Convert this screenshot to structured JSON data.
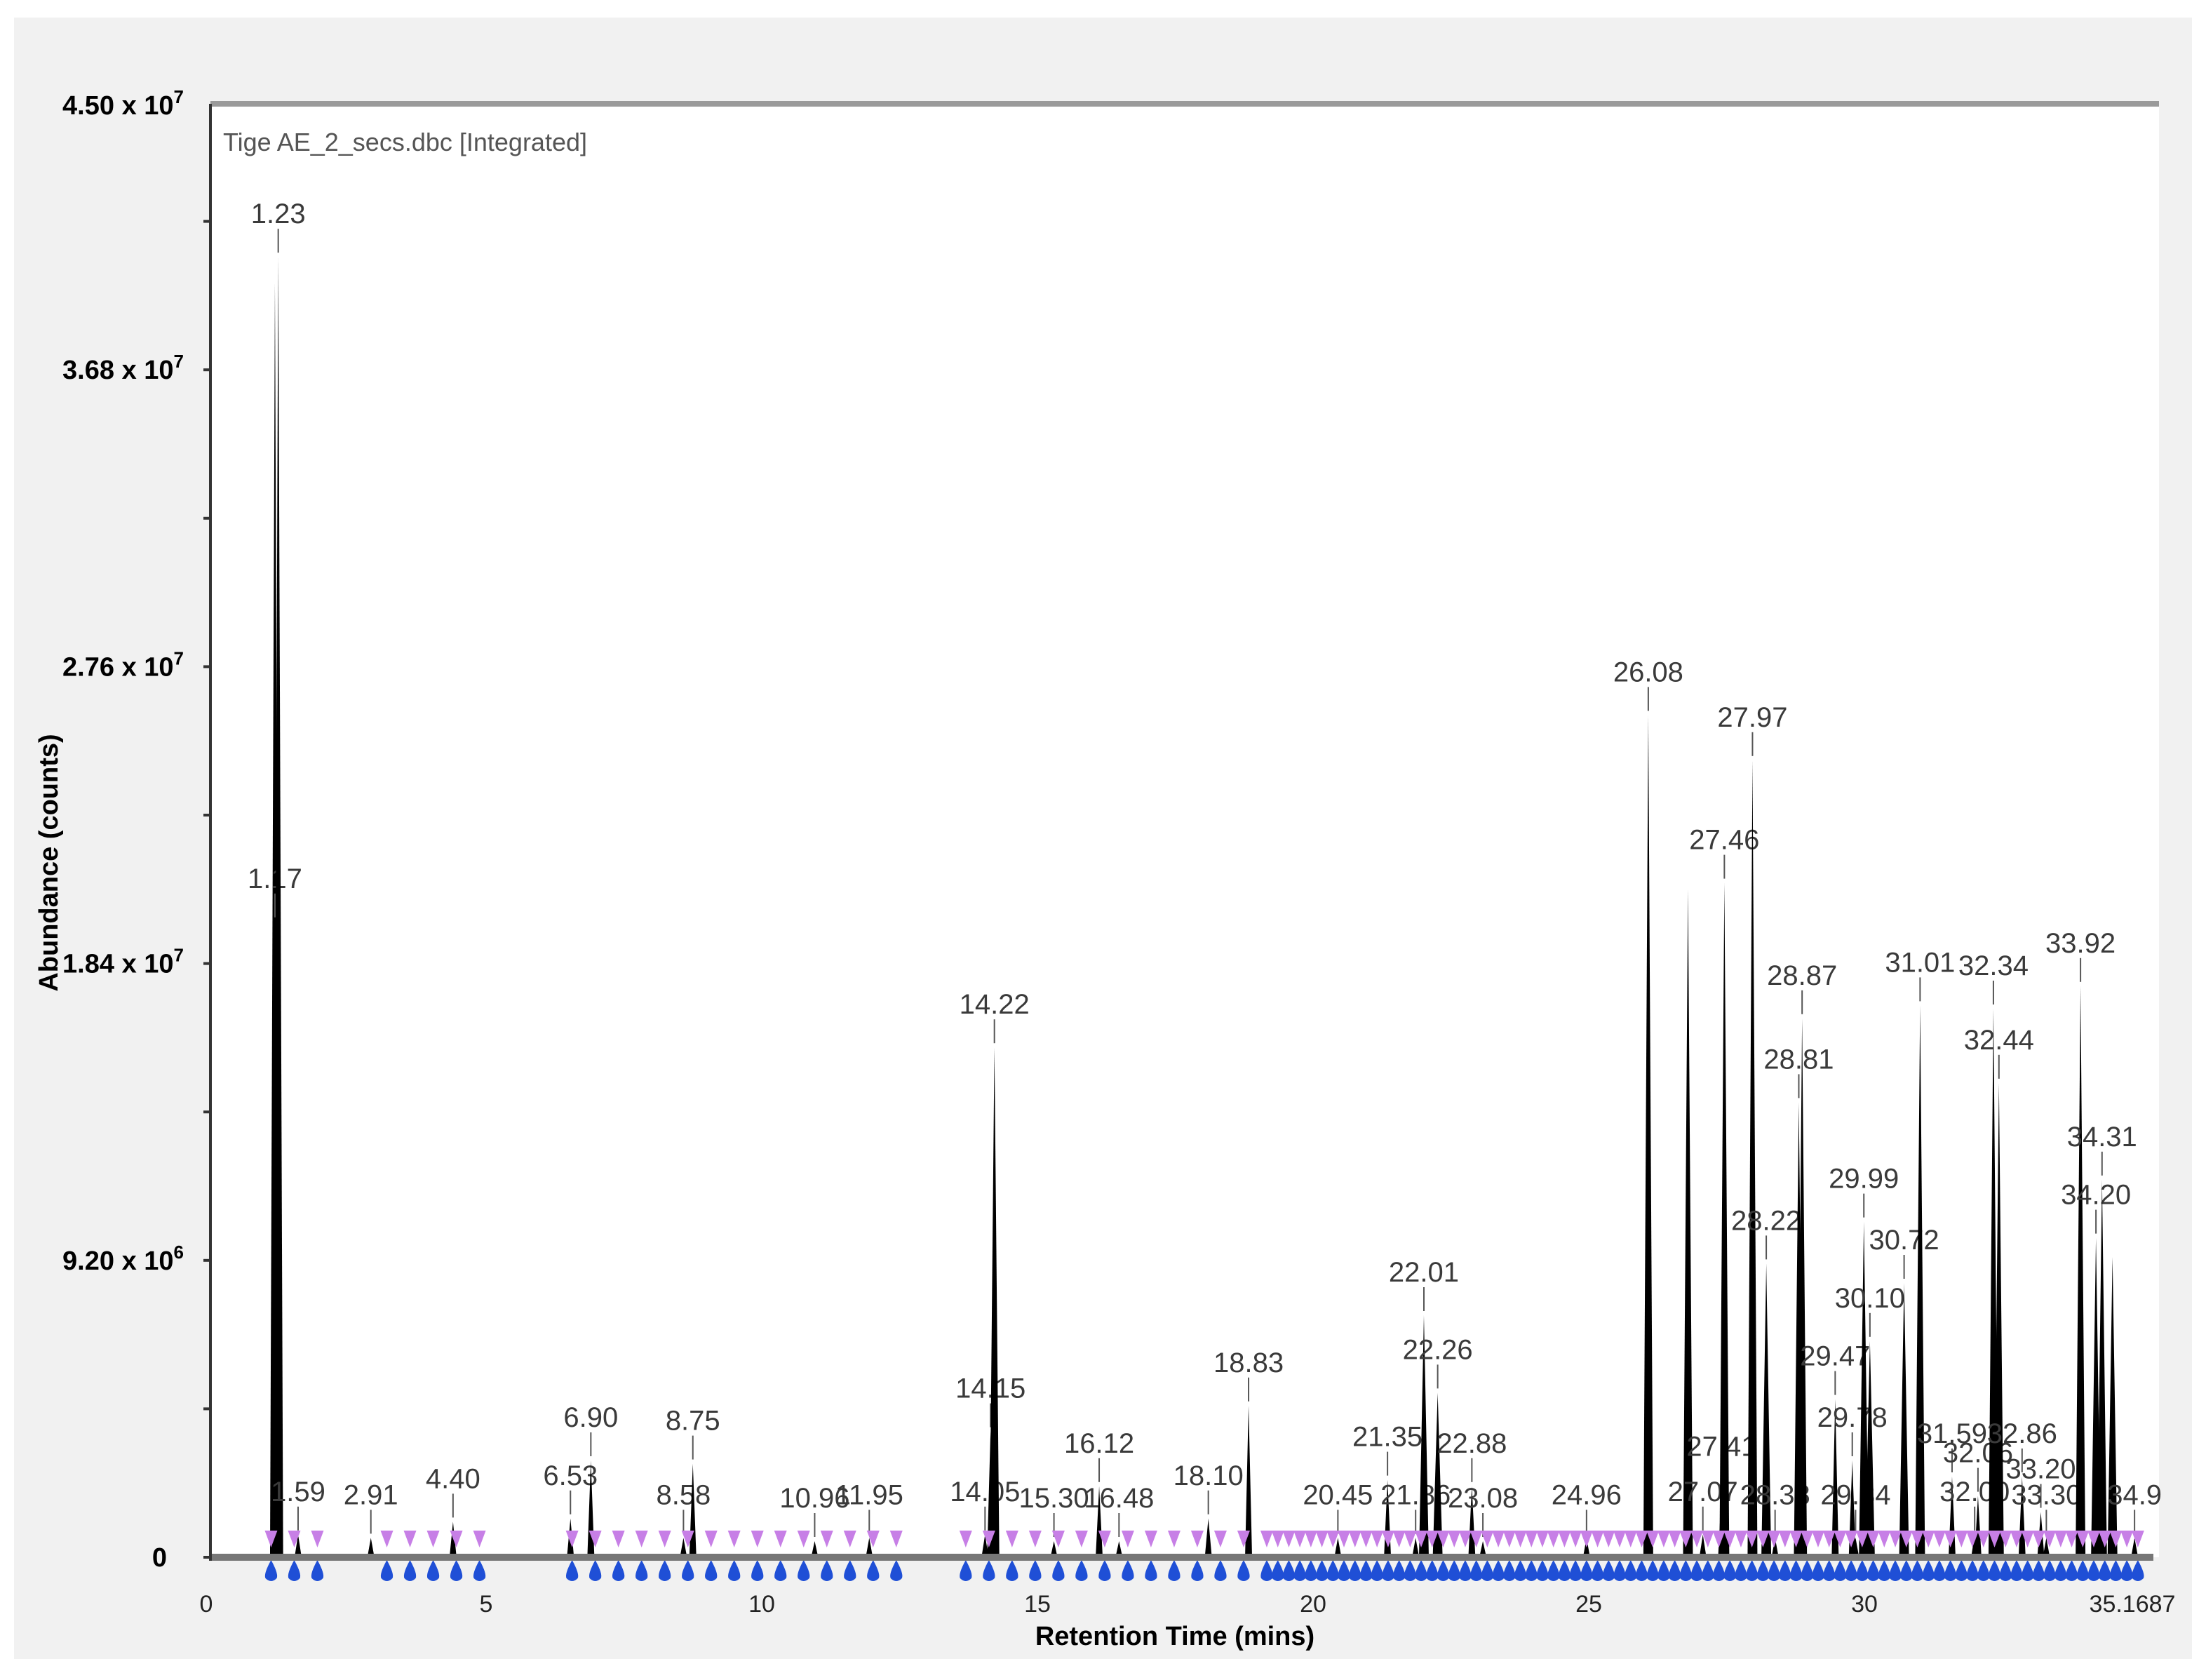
{
  "chart_data": {
    "type": "line",
    "title": "Tige AE_2_secs.dbc [Integrated]",
    "xlabel": "Retention Time (mins)",
    "ylabel": "Abundance (counts)",
    "xlim": [
      0,
      35.1687
    ],
    "ylim": [
      0,
      45000000
    ],
    "grid": false,
    "legend": "none",
    "x_ticks": [
      {
        "value": 0,
        "label": "0"
      },
      {
        "value": 5,
        "label": "5"
      },
      {
        "value": 10,
        "label": "10"
      },
      {
        "value": 15,
        "label": "15"
      },
      {
        "value": 20,
        "label": "20"
      },
      {
        "value": 25,
        "label": "25"
      },
      {
        "value": 30,
        "label": "30"
      }
    ],
    "x_end_label": "35.1687",
    "y_ticks": [
      {
        "value": 0,
        "mant": "0",
        "exp": ""
      },
      {
        "value": 9200000,
        "mant": "9.20 x 10",
        "exp": "6"
      },
      {
        "value": 18400000,
        "mant": "1.84 x 10",
        "exp": "7"
      },
      {
        "value": 27600000,
        "mant": "2.76 x 10",
        "exp": "7"
      },
      {
        "value": 36800000,
        "mant": "3.68 x 10",
        "exp": "7"
      },
      {
        "value": 45000000,
        "mant": "4.50 x 10",
        "exp": "7"
      }
    ],
    "y_minor_step": 4600000,
    "peaks": [
      {
        "rt": 1.17,
        "label": "1.17",
        "abundance": 39500000,
        "label_at": 19700000
      },
      {
        "rt": 1.23,
        "label": "1.23",
        "abundance": 40300000
      },
      {
        "rt": 1.59,
        "label": "1.59",
        "abundance": 700000
      },
      {
        "rt": 2.91,
        "label": "2.91",
        "abundance": 600000
      },
      {
        "rt": 4.4,
        "label": "4.40",
        "abundance": 1100000
      },
      {
        "rt": 6.53,
        "label": "6.53",
        "abundance": 1200000
      },
      {
        "rt": 6.9,
        "label": "6.90",
        "abundance": 3000000
      },
      {
        "rt": 8.58,
        "label": "8.58",
        "abundance": 600000
      },
      {
        "rt": 8.75,
        "label": "8.75",
        "abundance": 2900000
      },
      {
        "rt": 10.96,
        "label": "10.96",
        "abundance": 500000
      },
      {
        "rt": 11.95,
        "label": "11.95",
        "abundance": 600000
      },
      {
        "rt": 14.05,
        "label": "14.05",
        "abundance": 700000
      },
      {
        "rt": 14.15,
        "label": "14.15",
        "abundance": 3900000
      },
      {
        "rt": 14.22,
        "label": "14.22",
        "abundance": 15800000
      },
      {
        "rt": 15.3,
        "label": "15.30",
        "abundance": 500000
      },
      {
        "rt": 16.12,
        "label": "16.12",
        "abundance": 2200000
      },
      {
        "rt": 16.48,
        "label": "16.48",
        "abundance": 500000
      },
      {
        "rt": 18.1,
        "label": "18.10",
        "abundance": 1200000
      },
      {
        "rt": 18.83,
        "label": "18.83",
        "abundance": 4700000
      },
      {
        "rt": 20.45,
        "label": "20.45",
        "abundance": 600000
      },
      {
        "rt": 21.35,
        "label": "21.35",
        "abundance": 2400000
      },
      {
        "rt": 21.86,
        "label": "21.86",
        "abundance": 600000
      },
      {
        "rt": 22.01,
        "label": "22.01",
        "abundance": 7500000
      },
      {
        "rt": 22.26,
        "label": "22.26",
        "abundance": 5100000
      },
      {
        "rt": 22.88,
        "label": "22.88",
        "abundance": 2200000
      },
      {
        "rt": 23.08,
        "label": "23.08",
        "abundance": 500000
      },
      {
        "rt": 24.96,
        "label": "24.96",
        "abundance": 600000
      },
      {
        "rt": 26.08,
        "label": "26.08",
        "abundance": 26100000
      },
      {
        "rt": 26.8,
        "label": "",
        "abundance": 20700000
      },
      {
        "rt": 27.07,
        "label": "27.07",
        "abundance": 700000
      },
      {
        "rt": 27.41,
        "label": "27.41",
        "abundance": 2100000
      },
      {
        "rt": 27.46,
        "label": "27.46",
        "abundance": 20900000
      },
      {
        "rt": 27.97,
        "label": "27.97",
        "abundance": 24700000
      },
      {
        "rt": 28.22,
        "label": "28.22",
        "abundance": 9100000
      },
      {
        "rt": 28.38,
        "label": "28.38",
        "abundance": 600000
      },
      {
        "rt": 28.81,
        "label": "28.81",
        "abundance": 14100000
      },
      {
        "rt": 28.87,
        "label": "28.87",
        "abundance": 16700000
      },
      {
        "rt": 29.47,
        "label": "29.47",
        "abundance": 4900000
      },
      {
        "rt": 29.78,
        "label": "29.78",
        "abundance": 3000000
      },
      {
        "rt": 29.84,
        "label": "29.84",
        "abundance": 600000
      },
      {
        "rt": 29.99,
        "label": "29.99",
        "abundance": 10400000
      },
      {
        "rt": 30.1,
        "label": "30.10",
        "abundance": 6700000
      },
      {
        "rt": 30.72,
        "label": "30.72",
        "abundance": 8500000
      },
      {
        "rt": 31.01,
        "label": "31.01",
        "abundance": 17100000
      },
      {
        "rt": 31.59,
        "label": "31.59",
        "abundance": 2500000
      },
      {
        "rt": 32.0,
        "label": "32.00",
        "abundance": 700000
      },
      {
        "rt": 32.06,
        "label": "32.06",
        "abundance": 1900000
      },
      {
        "rt": 32.34,
        "label": "32.34",
        "abundance": 17000000
      },
      {
        "rt": 32.44,
        "label": "32.44",
        "abundance": 14700000
      },
      {
        "rt": 32.86,
        "label": "32.86",
        "abundance": 2500000
      },
      {
        "rt": 33.2,
        "label": "33.20",
        "abundance": 1400000
      },
      {
        "rt": 33.3,
        "label": "33.30",
        "abundance": 600000
      },
      {
        "rt": 33.92,
        "label": "33.92",
        "abundance": 17700000
      },
      {
        "rt": 34.2,
        "label": "34.20",
        "abundance": 9900000
      },
      {
        "rt": 34.31,
        "label": "34.31",
        "abundance": 11700000
      },
      {
        "rt": 34.5,
        "label": "",
        "abundance": 9300000
      },
      {
        "rt": 34.9,
        "label": "34.9",
        "abundance": 600000
      }
    ],
    "colors": {
      "trace": "#000000",
      "start_marker": "#c77fe6",
      "end_marker": "#1f4fd6",
      "label": "#3a3a3a",
      "frame": "#9a9a9a"
    }
  }
}
